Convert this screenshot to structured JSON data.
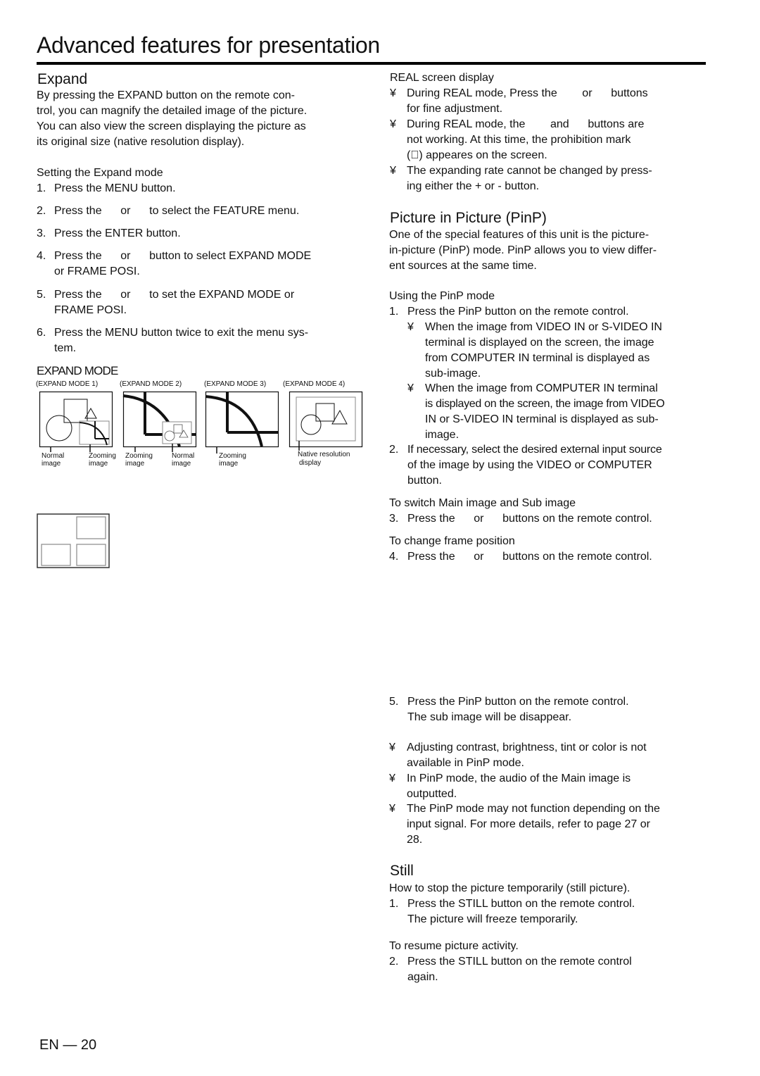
{
  "page": {
    "title": "Advanced features for presentation",
    "footer": "EN — 20"
  },
  "expand": {
    "heading": "Expand",
    "intro": [
      "By pressing the EXPAND button on the remote con-",
      "trol, you can magnify the detailed image of the picture.",
      "You can also view the screen displaying the picture as",
      "its original size (native resolution display)."
    ],
    "setting_heading": "Setting the Expand mode",
    "steps": [
      {
        "num": "1.",
        "lines": [
          "Press the MENU button."
        ]
      },
      {
        "num": "2.",
        "lines": [
          "Press the      or      to select the FEATURE menu."
        ]
      },
      {
        "num": "3.",
        "lines": [
          "Press the ENTER button."
        ]
      },
      {
        "num": "4.",
        "lines": [
          "Press the      or      button to select EXPAND MODE",
          "or FRAME POSI."
        ]
      },
      {
        "num": "5.",
        "lines": [
          "Press the      or      to set the EXPAND MODE or",
          "FRAME POSI."
        ]
      },
      {
        "num": "6.",
        "lines": [
          "Press the MENU button twice to exit the menu sys-",
          "tem."
        ]
      }
    ],
    "diagram": {
      "heading": "EXPAND MODE",
      "modes": [
        {
          "label": "(EXPAND MODE 1)",
          "captions": [
            [
              "Normal",
              "image"
            ],
            [
              "Zooming",
              "image"
            ]
          ]
        },
        {
          "label": "(EXPAND MODE 2)",
          "captions": [
            [
              "Zooming",
              "image"
            ],
            [
              "Normal",
              "image"
            ]
          ]
        },
        {
          "label": "(EXPAND MODE 3)",
          "captions": [
            [
              "Zooming",
              "image"
            ]
          ]
        },
        {
          "label": "(EXPAND MODE 4)",
          "captions": [
            [
              "Native resolution",
              "display"
            ]
          ]
        }
      ]
    }
  },
  "real": {
    "heading": "REAL screen display",
    "bullet": "¥",
    "bullets": [
      [
        "During REAL mode, Press the        or      buttons",
        "for fine adjustment."
      ],
      [
        "During REAL mode, the        and      buttons are",
        "not working. At this time, the prohibition mark",
        "(⃠) appeares on the screen."
      ],
      [
        "The expanding rate cannot be changed by press-",
        "ing either the + or - button."
      ]
    ]
  },
  "pinp": {
    "heading": "Picture in Picture (PinP)",
    "intro": [
      "One of the special features of this unit is the picture-",
      "in-picture (PinP) mode. PinP allows you to view differ-",
      "ent sources at the same time."
    ],
    "using_heading": "Using the PinP mode",
    "step1": {
      "num": "1.",
      "text": "Press the PinP button on the remote control."
    },
    "step1_bullets": [
      [
        "When the image from VIDEO IN or S-VIDEO IN",
        "terminal is displayed on the screen, the image",
        "from COMPUTER IN terminal is displayed as",
        "sub-image."
      ],
      [
        "When the image from COMPUTER IN terminal",
        "is displayed on the screen, the image from VIDEO",
        "IN or S-VIDEO IN terminal is displayed as sub-",
        "image."
      ]
    ],
    "step2": {
      "num": "2.",
      "lines": [
        "If necessary, select the desired external input source",
        "of the image by using the VIDEO or COMPUTER",
        "button."
      ]
    },
    "switch_heading": "To switch Main image and Sub image",
    "step3": {
      "num": "3.",
      "text": "Press the      or      buttons on the remote control."
    },
    "frame_heading": "To change frame position",
    "step4": {
      "num": "4.",
      "text": "Press the      or      buttons on the remote control."
    },
    "step5": {
      "num": "5.",
      "lines": [
        "Press the PinP button on the remote control.",
        "The sub image will be disappear."
      ]
    },
    "notes": [
      [
        "Adjusting contrast, brightness, tint or color is not",
        "available in PinP mode."
      ],
      [
        "In PinP mode, the audio of the Main image is",
        "outputted."
      ],
      [
        "The PinP mode may not function depending on the",
        "input signal. For more details, refer to page 27 or",
        "28."
      ]
    ]
  },
  "still": {
    "heading": "Still",
    "intro": "How to stop the picture temporarily (still picture).",
    "step1": {
      "num": "1.",
      "lines": [
        "Press the STILL button on the remote control.",
        "The picture will freeze temporarily."
      ]
    },
    "resume_heading": "To resume picture activity.",
    "step2": {
      "num": "2.",
      "lines": [
        "Press the STILL button on the remote control",
        "again."
      ]
    }
  }
}
